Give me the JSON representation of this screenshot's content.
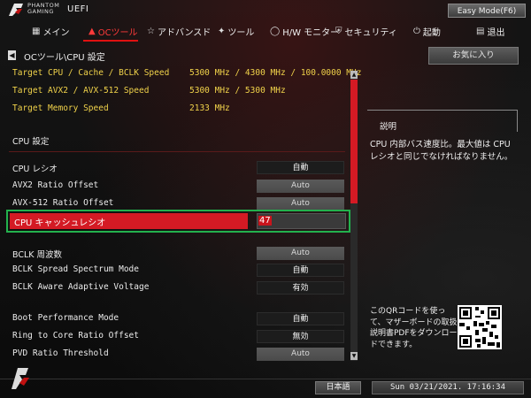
{
  "header": {
    "brand_line1": "PHANTOM",
    "brand_line2": "GAMING",
    "uefi": "UEFI",
    "easy_mode": "Easy Mode(F6)"
  },
  "nav": {
    "tabs": [
      {
        "label": "メイン",
        "icon": "grid-icon"
      },
      {
        "label": "OCツール",
        "icon": "rocket-icon"
      },
      {
        "label": "アドバンスド",
        "icon": "star-icon"
      },
      {
        "label": "ツール",
        "icon": "wrench-icon"
      },
      {
        "label": "H/W モニター",
        "icon": "monitor-icon"
      },
      {
        "label": "セキュリティ",
        "icon": "shield-icon"
      },
      {
        "label": "起動",
        "icon": "power-icon"
      },
      {
        "label": "退出",
        "icon": "exit-icon"
      }
    ],
    "active": "OCツール",
    "accent": "#e01010"
  },
  "breadcrumb": "OCツール\\CPU 設定",
  "info": [
    {
      "label": "Target CPU / Cache / BCLK Speed",
      "value": "5300 MHz / 4300 MHz / 100.0000 MHz"
    },
    {
      "label": "Target AVX2 / AVX-512 Speed",
      "value": "5300 MHz / 5300 MHz"
    },
    {
      "label": "Target Memory Speed",
      "value": "2133 MHz"
    }
  ],
  "section_title": "CPU 設定",
  "settings": [
    {
      "label": "CPU  レシオ",
      "value": "自動"
    },
    {
      "label": "AVX2 Ratio Offset",
      "value": "Auto"
    },
    {
      "label": "AVX-512 Ratio Offset",
      "value": "Auto"
    },
    {
      "label": "CPU  キャッシュレシオ",
      "value": "47"
    },
    {
      "label": "BCLK 周波数",
      "value": "Auto"
    },
    {
      "label": "BCLK Spread Spectrum Mode",
      "value": "自動"
    },
    {
      "label": "BCLK Aware Adaptive Voltage",
      "value": "有効"
    },
    {
      "label": "Boot Performance Mode",
      "value": "自動"
    },
    {
      "label": "Ring to Core Ratio Offset",
      "value": "無効"
    },
    {
      "label": "PVD Ratio Threshold",
      "value": "Auto"
    }
  ],
  "right": {
    "favorite": "お気に入り",
    "desc_title": "説明",
    "desc_body": "CPU 内部バス速度比。最大値は CPU レシオと同じでなければなりません。",
    "qr_text": "このQRコードを使って、マザーボードの取扱説明書PDFをダウンロードできます。"
  },
  "footer": {
    "language": "日本語",
    "datetime": "Sun 03/21/2021. 17:16:34"
  },
  "colors": {
    "highlight": "#d41a24",
    "focus_frame": "#23b14d",
    "info_text": "#f0d24a"
  }
}
